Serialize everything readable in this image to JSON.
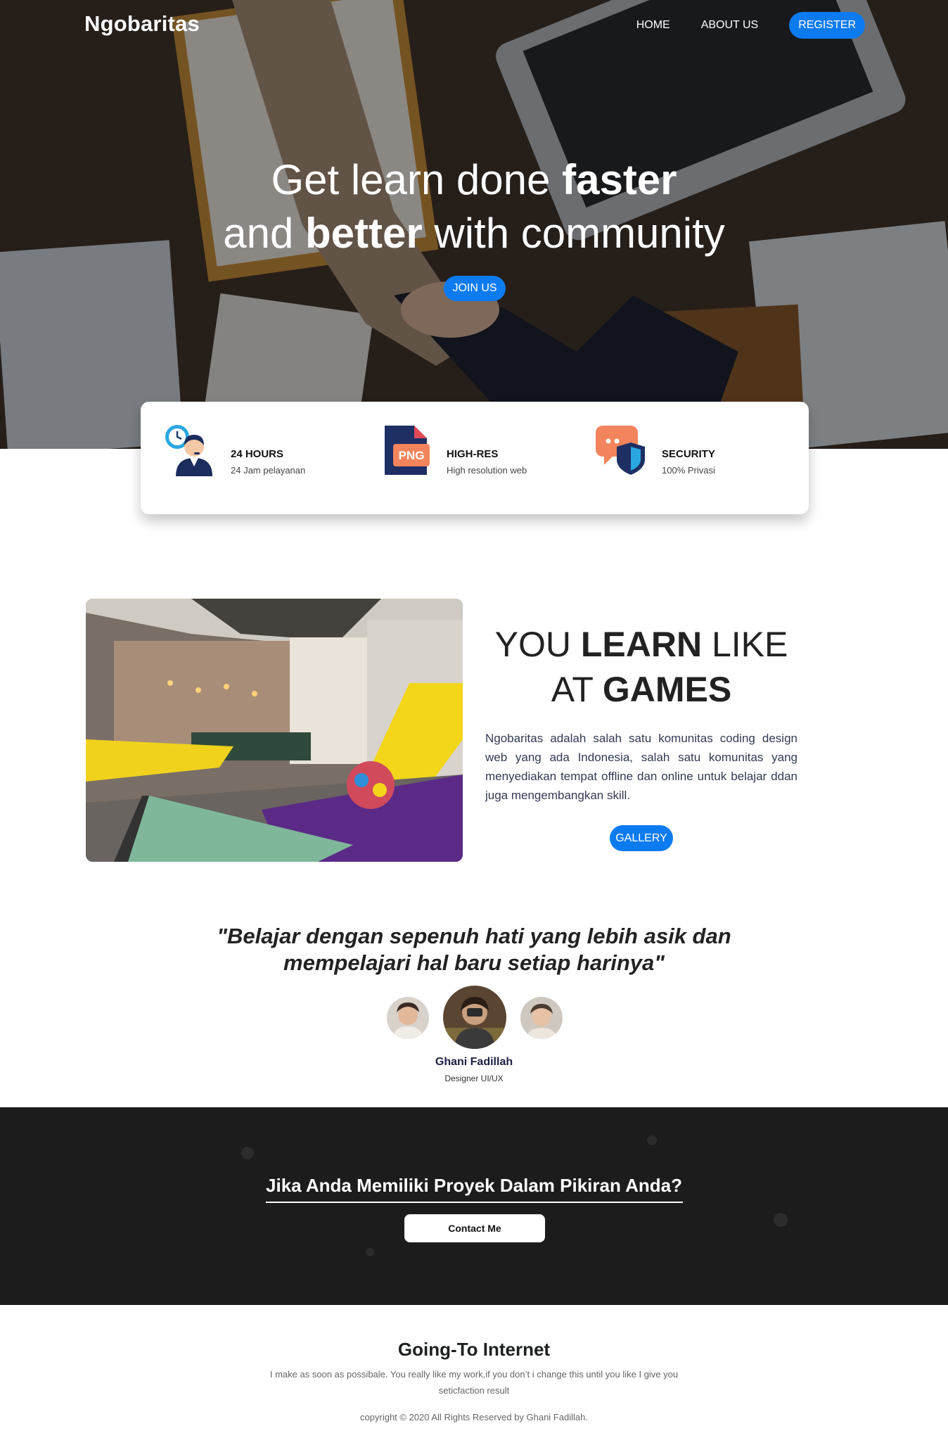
{
  "brand": "Ngobaritas",
  "nav": {
    "home": "HOME",
    "about": "ABOUT US",
    "register": "REGISTER"
  },
  "hero": {
    "line1_a": "Get learn done ",
    "line1_b": "faster",
    "line2_a": "and ",
    "line2_b": "better",
    "line2_c": " with community",
    "join": "JOIN US"
  },
  "features": [
    {
      "icon": "customer-service-clock-icon",
      "title": "24 HOURS",
      "subtitle": "24 Jam pelayanan"
    },
    {
      "icon": "png-file-icon",
      "title": "HIGH-RES",
      "subtitle": "High resolution web",
      "badge": "PNG"
    },
    {
      "icon": "chat-shield-icon",
      "title": "SECURITY",
      "subtitle": "100% Privasi"
    }
  ],
  "learn": {
    "t1_a": "YOU ",
    "t1_b": "LEARN",
    "t1_c": " LIKE",
    "t2_a": "AT ",
    "t2_b": "GAMES",
    "body": "Ngobaritas adalah salah satu komunitas coding design web yang ada Indonesia, salah satu komunitas yang menyediakan tempat offline dan online untuk belajar ddan juga mengembangkan skill.",
    "gallery": "GALLERY"
  },
  "quote": {
    "line1": "\"Belajar dengan sepenuh hati yang lebih asik dan",
    "line2": "mempelajari hal baru setiap harinya\"",
    "name": "Ghani Fadillah",
    "role": "Designer UI/UX"
  },
  "cta": {
    "title": "Jika Anda Memiliki Proyek Dalam Pikiran Anda?",
    "button": "Contact Me"
  },
  "footer": {
    "title": "Going-To Internet",
    "text": "I make as soon as possibale. You really like my work,if you don’t i change this until you like I give you seticfaction result",
    "copyright": "copyright © 2020 All Rights Reserved by Ghani Fadillah."
  },
  "colors": {
    "accent": "#0d7bf0",
    "dark_section": "#1c1c1c"
  }
}
